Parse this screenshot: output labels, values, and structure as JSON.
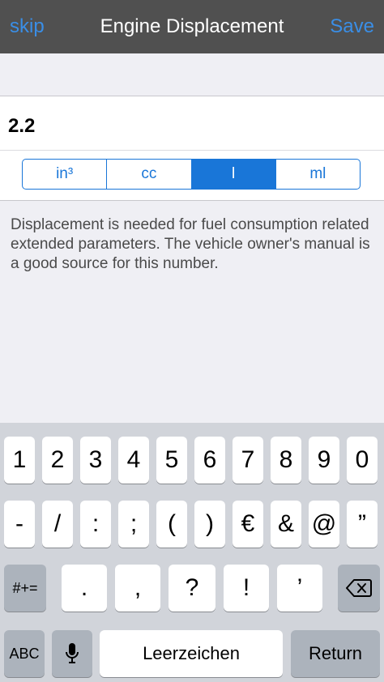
{
  "navbar": {
    "left_label": "skip",
    "title": "Engine Displacement",
    "right_label": "Save"
  },
  "value": "2.2",
  "units": {
    "options": [
      "in³",
      "cc",
      "l",
      "ml"
    ],
    "selected": "l"
  },
  "help_text": "Displacement is needed for fuel consumption related extended parameters. The vehicle owner's manual is a good source for this number.",
  "keyboard": {
    "row1": [
      "1",
      "2",
      "3",
      "4",
      "5",
      "6",
      "7",
      "8",
      "9",
      "0"
    ],
    "row2": [
      "-",
      "/",
      ":",
      ";",
      "(",
      ")",
      "€",
      "&",
      "@",
      "”"
    ],
    "row3_left": "#+=",
    "row3": [
      ".",
      ",",
      "?",
      "!",
      "’"
    ],
    "delete_icon": "backspace-icon",
    "abc_label": "ABC",
    "mic_icon": "microphone-icon",
    "space_label": "Leerzeichen",
    "return_label": "Return"
  }
}
